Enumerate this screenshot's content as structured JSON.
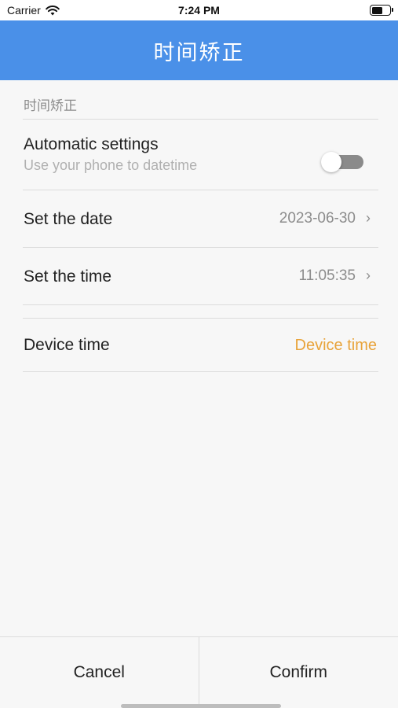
{
  "status_bar": {
    "carrier": "Carrier",
    "time": "7:24 PM",
    "icons": {
      "wifi": "wifi-icon",
      "battery": "battery-icon"
    }
  },
  "nav": {
    "title": "时间矫正"
  },
  "section": {
    "header": "时间矫正"
  },
  "rows": {
    "automatic": {
      "title": "Automatic settings",
      "subtitle": "Use your phone to datetime",
      "enabled": false
    },
    "date": {
      "title": "Set the date",
      "value": "2023-06-30"
    },
    "time": {
      "title": "Set the time",
      "value": "11:05:35"
    },
    "device": {
      "title": "Device time",
      "value": "Device time"
    }
  },
  "buttons": {
    "cancel": "Cancel",
    "confirm": "Confirm"
  },
  "colors": {
    "nav_background": "#4a90e8",
    "accent": "#e8a33a",
    "toggle_off": "#8a8a8a"
  }
}
